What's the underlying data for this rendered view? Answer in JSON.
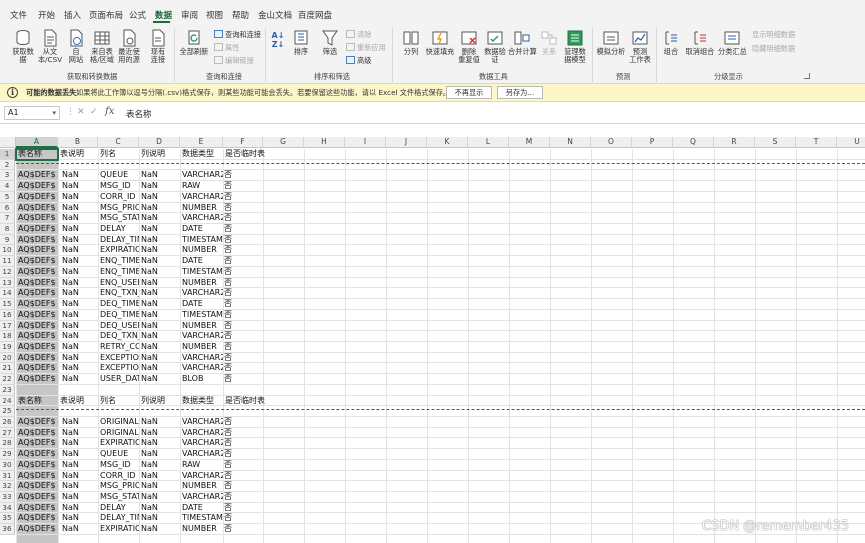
{
  "tabs": [
    "文件",
    "开始",
    "插入",
    "页面布局",
    "公式",
    "数据",
    "审阅",
    "视图",
    "帮助",
    "金山文档",
    "百度网盘"
  ],
  "active_tab": "数据",
  "ribbon": {
    "get_data": "获取数\n据",
    "from_text": "从文\n本/CSV",
    "from_web": "自\n网站",
    "from_table": "来自表\n格/区域",
    "recent_sources": "最近使\n用的源",
    "existing_connections": "现有\n连接",
    "refresh_all": "全部刷新",
    "queries_connections": "查询和连接",
    "properties": "属性",
    "edit_links": "编辑链接",
    "sort": "排序",
    "filter": "筛选",
    "clear": "清除",
    "reapply": "重新应用",
    "advanced": "高级",
    "text_to_columns": "分列",
    "flash_fill": "快速填充",
    "remove_duplicates": "删除\n重复值",
    "data_validation": "数据验\n证",
    "consolidate": "合并计算",
    "relationships": "关系",
    "data_model": "管理数\n据模型",
    "what_if": "模拟分析",
    "forecast_sheet": "预测\n工作表",
    "group": "组合",
    "ungroup": "取消组合",
    "subtotal": "分类汇总",
    "show_detail": "显示明细数据",
    "hide_detail": "隐藏明细数据",
    "groups": [
      "获取和转换数据",
      "查询和连接",
      "排序和筛选",
      "数据工具",
      "预测",
      "分级显示"
    ]
  },
  "message_bar": {
    "title": "可能的数据丢失",
    "text": "如果将此工作簿以逗号分隔(.csv)格式保存，则某些功能可能会丢失。若要保留这些功能，请以 Excel 文件格式保存。",
    "dont_show": "不再显示",
    "save_as": "另存为..."
  },
  "formula_bar": {
    "name_box": "A1",
    "fx": "fx",
    "value": "表名称"
  },
  "columns": [
    "A",
    "B",
    "C",
    "D",
    "E",
    "F",
    "G",
    "H",
    "I",
    "J",
    "K",
    "L",
    "M",
    "N",
    "O",
    "P",
    "Q",
    "R",
    "S",
    "T",
    "U"
  ],
  "rows": [
    [
      "表名称",
      "表说明",
      "列名",
      "列说明",
      "数据类型",
      "是否临时表"
    ],
    [
      "",
      "",
      "",
      "",
      "",
      ""
    ],
    [
      "AQ$DEF$",
      "NaN",
      "QUEUE",
      "NaN",
      "VARCHAR2",
      "否"
    ],
    [
      "AQ$DEF$",
      "NaN",
      "MSG_ID",
      "NaN",
      "RAW",
      "否"
    ],
    [
      "AQ$DEF$",
      "NaN",
      "CORR_ID",
      "NaN",
      "VARCHAR2",
      "否"
    ],
    [
      "AQ$DEF$",
      "NaN",
      "MSG_PRIO",
      "NaN",
      "NUMBER",
      "否"
    ],
    [
      "AQ$DEF$",
      "NaN",
      "MSG_STAT",
      "NaN",
      "VARCHAR2",
      "否"
    ],
    [
      "AQ$DEF$",
      "NaN",
      "DELAY",
      "NaN",
      "DATE",
      "否"
    ],
    [
      "AQ$DEF$",
      "NaN",
      "DELAY_TIN",
      "NaN",
      "TIMESTAM",
      "否"
    ],
    [
      "AQ$DEF$",
      "NaN",
      "EXPIRATIC",
      "NaN",
      "NUMBER",
      "否"
    ],
    [
      "AQ$DEF$",
      "NaN",
      "ENQ_TIME",
      "NaN",
      "DATE",
      "否"
    ],
    [
      "AQ$DEF$",
      "NaN",
      "ENQ_TIME",
      "NaN",
      "TIMESTAM",
      "否"
    ],
    [
      "AQ$DEF$",
      "NaN",
      "ENQ_USER",
      "NaN",
      "NUMBER",
      "否"
    ],
    [
      "AQ$DEF$",
      "NaN",
      "ENQ_TXN_",
      "NaN",
      "VARCHAR2",
      "否"
    ],
    [
      "AQ$DEF$",
      "NaN",
      "DEQ_TIME",
      "NaN",
      "DATE",
      "否"
    ],
    [
      "AQ$DEF$",
      "NaN",
      "DEQ_TIME",
      "NaN",
      "TIMESTAM",
      "否"
    ],
    [
      "AQ$DEF$",
      "NaN",
      "DEQ_USER",
      "NaN",
      "NUMBER",
      "否"
    ],
    [
      "AQ$DEF$",
      "NaN",
      "DEQ_TXN_",
      "NaN",
      "VARCHAR2",
      "否"
    ],
    [
      "AQ$DEF$",
      "NaN",
      "RETRY_CO",
      "NaN",
      "NUMBER",
      "否"
    ],
    [
      "AQ$DEF$",
      "NaN",
      "EXCEPTION",
      "NaN",
      "VARCHAR2",
      "否"
    ],
    [
      "AQ$DEF$",
      "NaN",
      "EXCEPTION",
      "NaN",
      "VARCHAR2",
      "否"
    ],
    [
      "AQ$DEF$",
      "NaN",
      "USER_DAT",
      "NaN",
      "BLOB",
      "否"
    ],
    [
      "",
      "",
      "",
      "",
      "",
      ""
    ],
    [
      "表名称",
      "表说明",
      "列名",
      "列说明",
      "数据类型",
      "是否临时表"
    ],
    [
      "",
      "",
      "",
      "",
      "",
      ""
    ],
    [
      "AQ$DEF$",
      "NaN",
      "ORIGINAL_",
      "NaN",
      "VARCHAR2",
      "否"
    ],
    [
      "AQ$DEF$",
      "NaN",
      "ORIGINAL_",
      "NaN",
      "VARCHAR2",
      "否"
    ],
    [
      "AQ$DEF$",
      "NaN",
      "EXPIRATIC",
      "NaN",
      "VARCHAR2",
      "否"
    ],
    [
      "AQ$DEF$",
      "NaN",
      "QUEUE",
      "NaN",
      "VARCHAR2",
      "否"
    ],
    [
      "AQ$DEF$",
      "NaN",
      "MSG_ID",
      "NaN",
      "RAW",
      "否"
    ],
    [
      "AQ$DEF$",
      "NaN",
      "CORR_ID",
      "NaN",
      "VARCHAR2",
      "否"
    ],
    [
      "AQ$DEF$",
      "NaN",
      "MSG_PRIO",
      "NaN",
      "NUMBER",
      "否"
    ],
    [
      "AQ$DEF$",
      "NaN",
      "MSG_STAT",
      "NaN",
      "VARCHAR2",
      "否"
    ],
    [
      "AQ$DEF$",
      "NaN",
      "DELAY",
      "NaN",
      "DATE",
      "否"
    ],
    [
      "AQ$DEF$",
      "NaN",
      "DELAY_TIN",
      "NaN",
      "TIMESTAM",
      "否"
    ],
    [
      "AQ$DEF$",
      "NaN",
      "EXPIRATIC",
      "NaN",
      "NUMBER",
      "否"
    ]
  ],
  "watermark": "CSDN @remember435"
}
